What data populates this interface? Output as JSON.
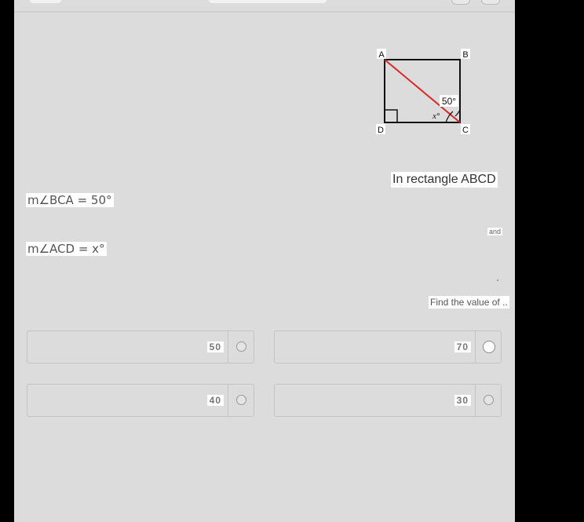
{
  "question": {
    "intro": "In rectangle ABCD",
    "angle_bca": "m∠BCA = 50°",
    "conjunction": "and",
    "angle_acd": "m∠ACD = x°",
    "prompt": "Find the value of ..",
    "diagram": {
      "vertex_a": "A",
      "vertex_b": "B",
      "vertex_c": "C",
      "vertex_d": "D",
      "angle_label_50": "50°",
      "angle_label_x": "x°",
      "diagonal_color": "#d62828"
    }
  },
  "options": [
    {
      "value": "50",
      "selected": false
    },
    {
      "value": "70",
      "selected": false
    },
    {
      "value": "40",
      "selected": false
    },
    {
      "value": "30",
      "selected": false
    }
  ]
}
